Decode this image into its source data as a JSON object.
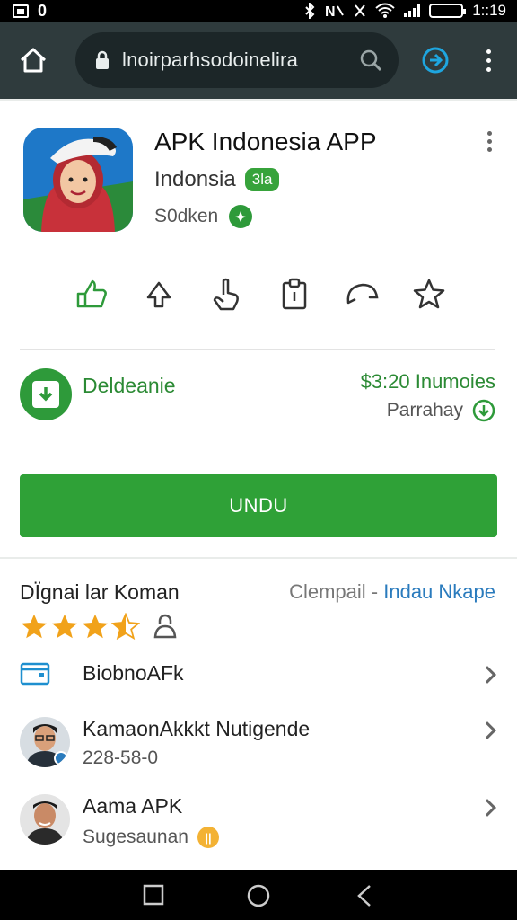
{
  "status_bar": {
    "left_glyph": "0",
    "time": "1::19"
  },
  "browser": {
    "url": "lnoirparhsodoinelira"
  },
  "app": {
    "title": "APK Indonesia APP",
    "developer": "Indonsia",
    "developer_badge": "3la",
    "meta": "S0dken"
  },
  "download": {
    "label": "Deldeanie",
    "price": "$3:20 Inumoies",
    "sub": "Parrahay"
  },
  "install": {
    "label": "UNDU"
  },
  "details": {
    "header_left": "DÏgnai lar Koman",
    "header_right_gray": "Clempail - ",
    "header_right_blue": "Indau Nkape",
    "rating": 3.5,
    "rows": [
      {
        "title": "BiobnoAFk",
        "subtitle": ""
      },
      {
        "title": "KamaonAkkkt Nutigende",
        "subtitle": "228-58-0"
      },
      {
        "title": "Aama APK",
        "subtitle": "Sugesaunan"
      }
    ]
  },
  "colors": {
    "accent_green": "#2fa137",
    "link_blue": "#2a7bbd",
    "star_orange": "#f1a21a"
  }
}
